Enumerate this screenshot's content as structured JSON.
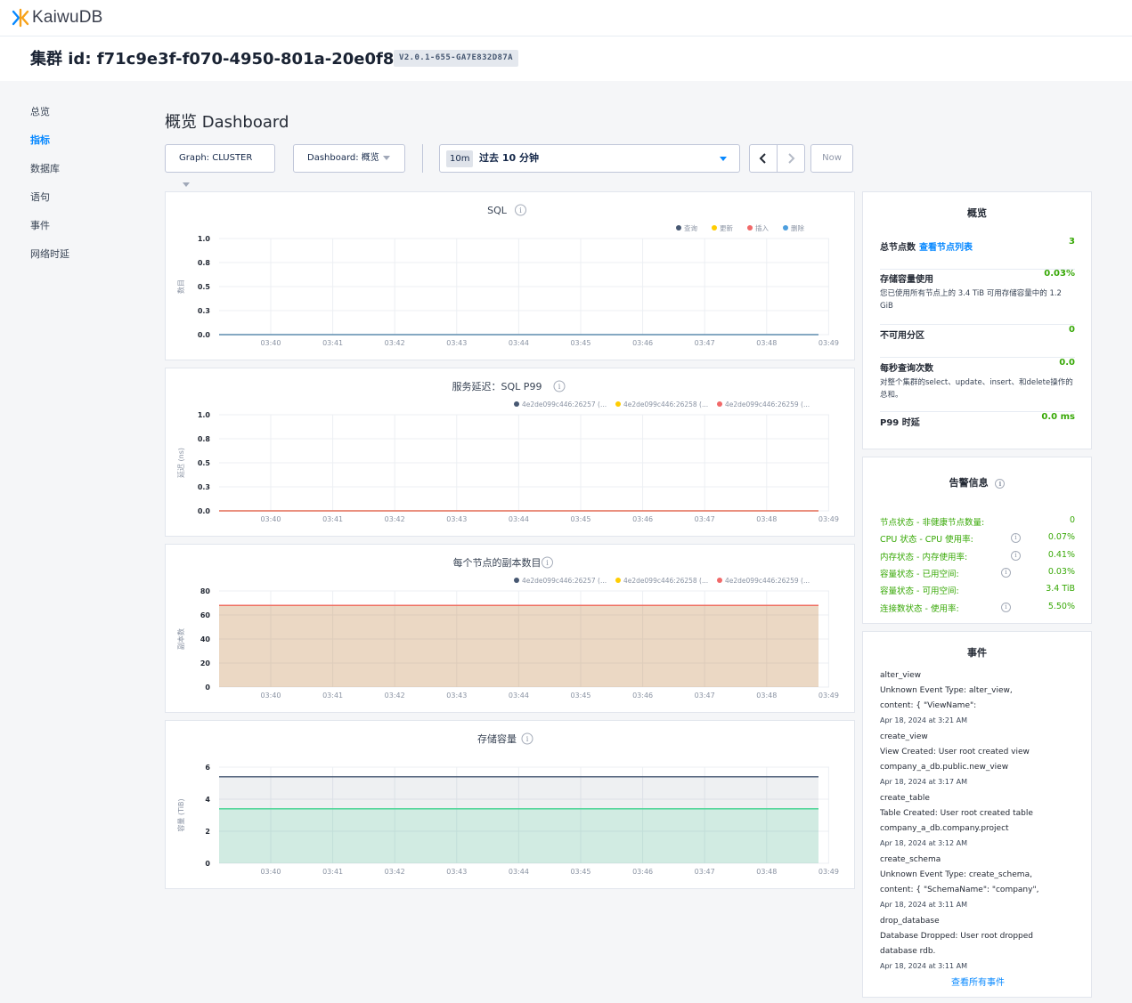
{
  "app": {
    "logo_text": "KaiwuDB"
  },
  "cluster": {
    "title": "集群 id: f71c9e3f-f070-4950-801a-20e0f8f30249",
    "version": "V2.0.1-655-GA7E832D87A"
  },
  "nav": {
    "items": [
      {
        "label": "总览",
        "active": false
      },
      {
        "label": "指标",
        "active": true
      },
      {
        "label": "数据库",
        "active": false
      },
      {
        "label": "语句",
        "active": false
      },
      {
        "label": "事件",
        "active": false
      },
      {
        "label": "网络时延",
        "active": false
      }
    ]
  },
  "page": {
    "title": "概览 Dashboard"
  },
  "controls": {
    "graph_label": "Graph: CLUSTER",
    "dashboard_label": "Dashboard: 概览",
    "time_badge": "10m",
    "time_label": "过去 10 分钟",
    "prev_icon": "chevron-left-icon",
    "next_icon": "chevron-right-icon",
    "now_label": "Now"
  },
  "colors": {
    "accent": "#0788ff",
    "green": "#37a806",
    "series_navy": "#475872",
    "series_yellow": "#ffcd02",
    "series_red": "#f16969",
    "series_blue": "#4e9fde",
    "series_teal": "#3cd38e"
  },
  "chart_data": [
    {
      "id": "sql",
      "type": "line",
      "title": "SQL",
      "ylabel": "数目",
      "x": [
        "03:40",
        "03:41",
        "03:42",
        "03:43",
        "03:44",
        "03:45",
        "03:46",
        "03:47",
        "03:48",
        "03:49"
      ],
      "yticks": [
        "1.0",
        "0.8",
        "0.5",
        "0.3",
        "0.0"
      ],
      "ylim": [
        0,
        1
      ],
      "grid": true,
      "legend_position": "top-right",
      "series": [
        {
          "name": "查询",
          "color": "#475872",
          "values": [
            0,
            0,
            0,
            0,
            0,
            0,
            0,
            0,
            0,
            0
          ]
        },
        {
          "name": "更新",
          "color": "#ffcd02",
          "values": [
            0,
            0,
            0,
            0,
            0,
            0,
            0,
            0,
            0,
            0
          ]
        },
        {
          "name": "插入",
          "color": "#f16969",
          "values": [
            0,
            0,
            0,
            0,
            0,
            0,
            0,
            0,
            0,
            0
          ]
        },
        {
          "name": "删除",
          "color": "#4e9fde",
          "values": [
            0,
            0,
            0,
            0,
            0,
            0,
            0,
            0,
            0,
            0
          ]
        }
      ]
    },
    {
      "id": "latency",
      "type": "line",
      "title": "服务延迟：SQL P99",
      "ylabel": "延迟 (ns)",
      "x": [
        "03:40",
        "03:41",
        "03:42",
        "03:43",
        "03:44",
        "03:45",
        "03:46",
        "03:47",
        "03:48",
        "03:49"
      ],
      "yticks": [
        "1.0",
        "0.8",
        "0.5",
        "0.3",
        "0.0"
      ],
      "ylim": [
        0,
        1
      ],
      "grid": true,
      "legend_position": "top-right",
      "series": [
        {
          "name": "4e2de099c446:26257 (...",
          "color": "#475872",
          "values": [
            0,
            0,
            0,
            0,
            0,
            0,
            0,
            0,
            0,
            0
          ]
        },
        {
          "name": "4e2de099c446:26258 (...",
          "color": "#ffcd02",
          "values": [
            0,
            0,
            0,
            0,
            0,
            0,
            0,
            0,
            0,
            0
          ]
        },
        {
          "name": "4e2de099c446:26259 (...",
          "color": "#f16969",
          "values": [
            0,
            0,
            0,
            0,
            0,
            0,
            0,
            0,
            0,
            0
          ]
        }
      ]
    },
    {
      "id": "replicas",
      "type": "area",
      "title": "每个节点的副本数目",
      "ylabel": "副本数",
      "x": [
        "03:40",
        "03:41",
        "03:42",
        "03:43",
        "03:44",
        "03:45",
        "03:46",
        "03:47",
        "03:48",
        "03:49"
      ],
      "yticks": [
        "80",
        "60",
        "40",
        "20",
        "0"
      ],
      "ylim": [
        0,
        80
      ],
      "grid": true,
      "legend_position": "top-right",
      "series": [
        {
          "name": "4e2de099c446:26257 (...",
          "color": "#475872",
          "values": [
            68,
            68,
            68,
            68,
            68,
            68,
            68,
            68,
            68,
            68
          ]
        },
        {
          "name": "4e2de099c446:26258 (...",
          "color": "#ffcd02",
          "values": [
            68,
            68,
            68,
            68,
            68,
            68,
            68,
            68,
            68,
            68
          ]
        },
        {
          "name": "4e2de099c446:26259 (...",
          "color": "#f16969",
          "values": [
            68,
            68,
            68,
            68,
            68,
            68,
            68,
            68,
            68,
            68
          ]
        }
      ]
    },
    {
      "id": "storage",
      "type": "area",
      "title": "存储容量",
      "ylabel": "容量 (TiB)",
      "x": [
        "03:40",
        "03:41",
        "03:42",
        "03:43",
        "03:44",
        "03:45",
        "03:46",
        "03:47",
        "03:48",
        "03:49"
      ],
      "yticks": [
        "6",
        "4",
        "2",
        "0"
      ],
      "ylim": [
        0,
        6
      ],
      "grid": true,
      "series": [
        {
          "color": "#475872",
          "values": [
            5.4,
            5.4,
            5.4,
            5.4,
            5.4,
            5.4,
            5.4,
            5.4,
            5.4,
            5.4
          ]
        },
        {
          "color": "#3cd38e",
          "values": [
            3.4,
            3.4,
            3.4,
            3.4,
            3.4,
            3.4,
            3.4,
            3.4,
            3.4,
            3.4
          ]
        }
      ]
    }
  ],
  "summary": {
    "title": "概览",
    "rows": [
      {
        "label": "总节点数",
        "link": "查看节点列表",
        "value": "3",
        "desc": ""
      },
      {
        "label": "存储容量使用",
        "link": "",
        "value": "0.03%",
        "desc": "您已使用所有节点上的 3.4 TiB 可用存储容量中的 1.2 GiB"
      },
      {
        "label": "不可用分区",
        "link": "",
        "value": "0",
        "desc": ""
      },
      {
        "label": "每秒查询次数",
        "link": "",
        "value": "0.0",
        "desc": "对整个集群的select、update、insert、和delete操作的总和。"
      },
      {
        "label": "P99 时延",
        "link": "",
        "value": "0.0 ms",
        "desc": ""
      }
    ]
  },
  "alerts": {
    "title": "告警信息",
    "rows": [
      {
        "label": "节点状态 - 非健康节点数量:",
        "value": "0",
        "info": false
      },
      {
        "label": "CPU 状态 - CPU 使用率:",
        "value": "0.07%",
        "info": true
      },
      {
        "label": "内存状态 - 内存使用率:",
        "value": "0.41%",
        "info": true
      },
      {
        "label": "容量状态 - 已用空间:",
        "value": "0.03%",
        "info": true
      },
      {
        "label": "容量状态 - 可用空间:",
        "value": "3.4 TiB",
        "info": false
      },
      {
        "label": "连接数状态 - 使用率:",
        "value": "5.50%",
        "info": true
      }
    ]
  },
  "events": {
    "title": "事件",
    "items": [
      {
        "lines": [
          "alter_view",
          "Unknown Event Type: alter_view,",
          "content: { \"ViewName\":"
        ],
        "time": "Apr 18, 2024 at 3:21 AM"
      },
      {
        "lines": [
          "create_view",
          "View Created: User root created view",
          "company_a_db.public.new_view"
        ],
        "time": "Apr 18, 2024 at 3:17 AM"
      },
      {
        "lines": [
          "create_table",
          "Table Created: User root created table",
          "company_a_db.company.project"
        ],
        "time": "Apr 18, 2024 at 3:12 AM"
      },
      {
        "lines": [
          "create_schema",
          "Unknown Event Type: create_schema,",
          "content: { \"SchemaName\": \"company\","
        ],
        "time": "Apr 18, 2024 at 3:11 AM"
      },
      {
        "lines": [
          "drop_database",
          "Database Dropped: User root dropped",
          "database rdb."
        ],
        "time": "Apr 18, 2024 at 3:11 AM"
      }
    ],
    "view_all": "查看所有事件"
  }
}
